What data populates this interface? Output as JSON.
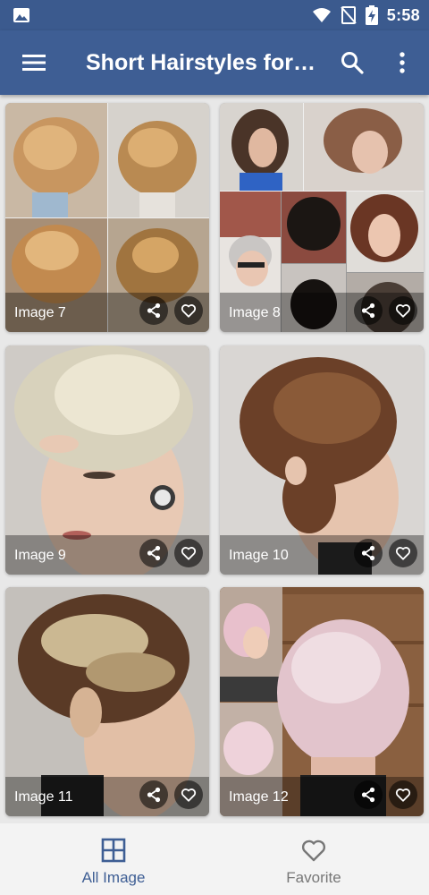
{
  "status_bar": {
    "time": "5:58",
    "icons": [
      "gallery-icon",
      "wifi-icon",
      "no-signal-icon",
      "battery-charging-icon"
    ]
  },
  "app_bar": {
    "title": "Short Hairstyles for…",
    "icons": [
      "menu-icon",
      "search-icon",
      "more-vert-icon"
    ]
  },
  "cards": [
    {
      "caption": "Image 7"
    },
    {
      "caption": "Image 8"
    },
    {
      "caption": "Image 9"
    },
    {
      "caption": "Image 10"
    },
    {
      "caption": "Image 11"
    },
    {
      "caption": "Image 12"
    }
  ],
  "bottom_nav": {
    "items": [
      {
        "label": "All Image",
        "icon": "grid-icon",
        "active": true
      },
      {
        "label": "Favorite",
        "icon": "heart-icon",
        "active": false
      }
    ]
  },
  "colors": {
    "primary": "#3e5e94",
    "active_nav": "#3e5e94",
    "inactive_nav": "#777777"
  }
}
